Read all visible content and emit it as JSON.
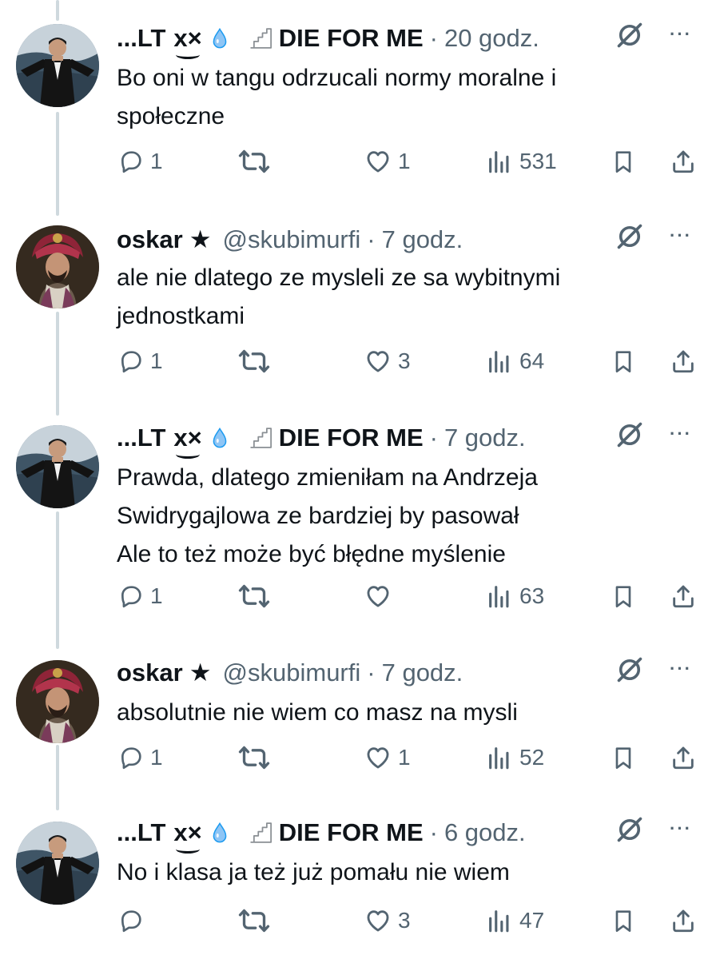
{
  "tweets": [
    {
      "author_name": "...LT",
      "author_suffix": "x×",
      "display_extra": "DIE FOR ME",
      "handle": "",
      "time": "20 godz.",
      "text_lines": [
        "Bo oni w tangu odrzucali normy moralne i",
        "społeczne"
      ],
      "replies": "1",
      "retweets": "",
      "likes": "1",
      "views": "531",
      "avatar": "man-in-tuxedo"
    },
    {
      "author_name": "oskar",
      "author_suffix": "★",
      "display_extra": "",
      "handle": "@skubimurfi",
      "time": "7 godz.",
      "text_lines": [
        "ale nie dlatego ze mysleli ze sa wybitnymi",
        "jednostkami"
      ],
      "replies": "1",
      "retweets": "",
      "likes": "3",
      "views": "64",
      "avatar": "man-in-red-turban"
    },
    {
      "author_name": "...LT",
      "author_suffix": "x×",
      "display_extra": "DIE FOR ME",
      "handle": "",
      "time": "7 godz.",
      "text_lines": [
        "Prawda, dlatego zmieniłam na Andrzeja",
        "Swidrygajlowa ze bardziej by pasował",
        "Ale to też może być błędne myślenie"
      ],
      "replies": "1",
      "retweets": "",
      "likes": "",
      "views": "63",
      "avatar": "man-in-tuxedo"
    },
    {
      "author_name": "oskar",
      "author_suffix": "★",
      "display_extra": "",
      "handle": "@skubimurfi",
      "time": "7 godz.",
      "text_lines": [
        "absolutnie nie wiem co masz na mysli"
      ],
      "replies": "1",
      "retweets": "",
      "likes": "1",
      "views": "52",
      "avatar": "man-in-red-turban"
    },
    {
      "author_name": "...LT",
      "author_suffix": "x×",
      "display_extra": "DIE FOR ME",
      "handle": "",
      "time": "6 godz.",
      "text_lines": [
        "No i klasa ja też już pomału nie wiem"
      ],
      "replies": "",
      "retweets": "",
      "likes": "3",
      "views": "47",
      "avatar": "man-in-tuxedo"
    }
  ],
  "separator": "·",
  "icons": {
    "drop": "water-drop-icon",
    "stairs": "stairs-icon",
    "grok": "grok-icon",
    "more": "more-icon",
    "reply": "reply-icon",
    "retweet": "retweet-icon",
    "like": "like-icon",
    "views": "views-icon",
    "bookmark": "bookmark-icon",
    "share": "share-icon"
  },
  "colors": {
    "text": "#0f1419",
    "secondary": "#536471",
    "thread_line": "#cfd9de",
    "drop": "#1d9bf0"
  }
}
